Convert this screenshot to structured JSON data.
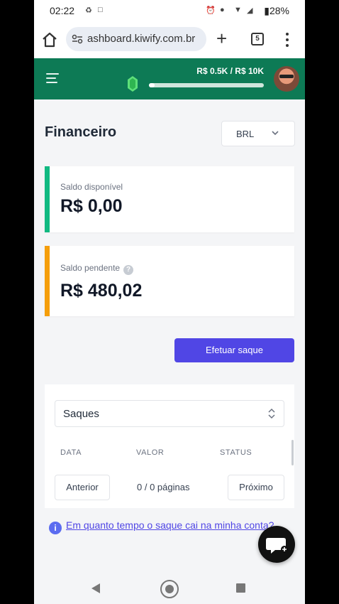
{
  "status_bar": {
    "time": "02:22",
    "battery": "28%"
  },
  "browser": {
    "url": "ashboard.kiwify.com.br",
    "tab_count": "5"
  },
  "header": {
    "goal_text": "R$ 0.5K / R$ 10K",
    "goal_progress": 0.05,
    "accent_color": "#0d7a55"
  },
  "page": {
    "title": "Financeiro",
    "currency": "BRL"
  },
  "balances": {
    "available_label": "Saldo disponível",
    "available_amount": "R$ 0,00",
    "available_color": "#10b981",
    "pending_label": "Saldo pendente",
    "pending_help": "?",
    "pending_amount": "R$ 480,02",
    "pending_color": "#f59e0b"
  },
  "actions": {
    "withdraw_label": "Efetuar saque"
  },
  "withdrawals": {
    "filter_value": "Saques",
    "columns": [
      "DATA",
      "VALOR",
      "STATUS"
    ],
    "prev_label": "Anterior",
    "page_info": "0 / 0 páginas",
    "next_label": "Próximo"
  },
  "faq": {
    "info_glyph": "i",
    "text": "Em quanto tempo o saque cai na minha conta?"
  }
}
